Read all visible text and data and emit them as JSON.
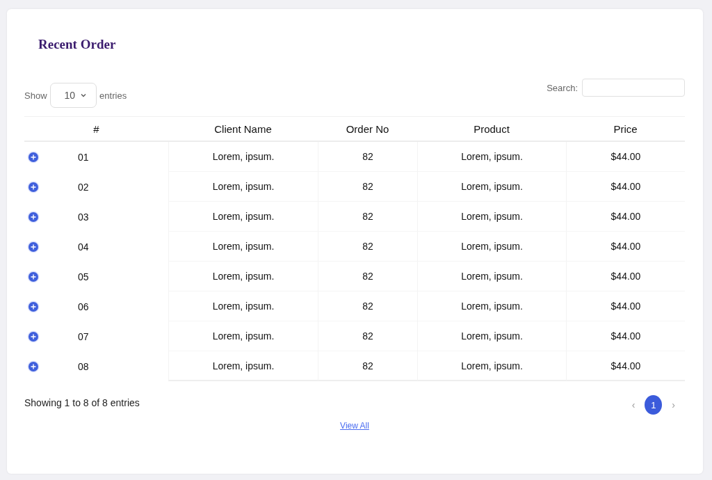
{
  "card": {
    "title": "Recent Order"
  },
  "length_control": {
    "label_before": "Show",
    "value": "10",
    "label_after": "entries"
  },
  "search": {
    "label": "Search:"
  },
  "table": {
    "columns": [
      "#",
      "Client Name",
      "Order No",
      "Product",
      "Price"
    ],
    "rows": [
      [
        "01",
        "Lorem, ipsum.",
        "82",
        "Lorem, ipsum.",
        "$44.00"
      ],
      [
        "02",
        "Lorem, ipsum.",
        "82",
        "Lorem, ipsum.",
        "$44.00"
      ],
      [
        "03",
        "Lorem, ipsum.",
        "82",
        "Lorem, ipsum.",
        "$44.00"
      ],
      [
        "04",
        "Lorem, ipsum.",
        "82",
        "Lorem, ipsum.",
        "$44.00"
      ],
      [
        "05",
        "Lorem, ipsum.",
        "82",
        "Lorem, ipsum.",
        "$44.00"
      ],
      [
        "06",
        "Lorem, ipsum.",
        "82",
        "Lorem, ipsum.",
        "$44.00"
      ],
      [
        "07",
        "Lorem, ipsum.",
        "82",
        "Lorem, ipsum.",
        "$44.00"
      ],
      [
        "08",
        "Lorem, ipsum.",
        "82",
        "Lorem, ipsum.",
        "$44.00"
      ]
    ]
  },
  "info": "Showing 1 to 8 of 8 entries",
  "pagination": {
    "previous": "‹",
    "pages": [
      {
        "label": "1",
        "selected": true
      }
    ],
    "next": "›"
  },
  "view_all_link": "View All"
}
